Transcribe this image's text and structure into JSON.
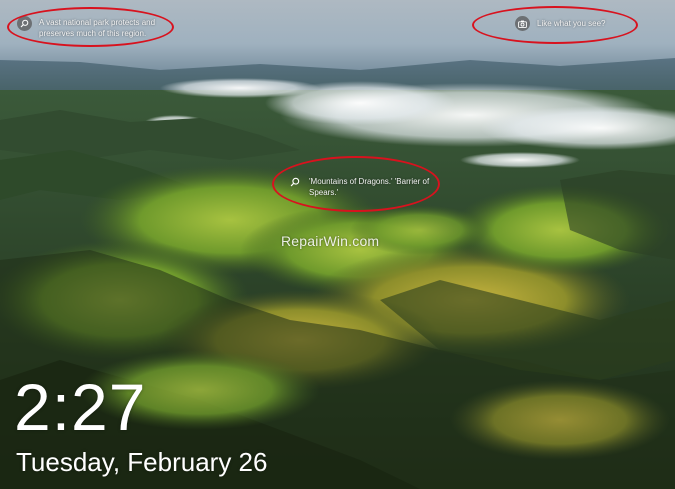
{
  "lock_screen": {
    "time": "2:27",
    "date": "Tuesday, February 26"
  },
  "spotlight": {
    "top_left_fact": {
      "icon": "search-icon",
      "line1": "A vast national park protects and",
      "line2": "preserves much of this region."
    },
    "top_right_prompt": {
      "icon": "camera-icon",
      "text": "Like what you see?"
    },
    "center_fact": {
      "icon": "search-icon",
      "line1": "'Mountains of Dragons.' 'Barrier of",
      "line2": "Spears.'"
    }
  },
  "watermark": "RepairWin.com",
  "colors": {
    "highlight_ring": "#d8121e",
    "icon_bg": "#5a5a5a",
    "text": "#ffffff"
  }
}
